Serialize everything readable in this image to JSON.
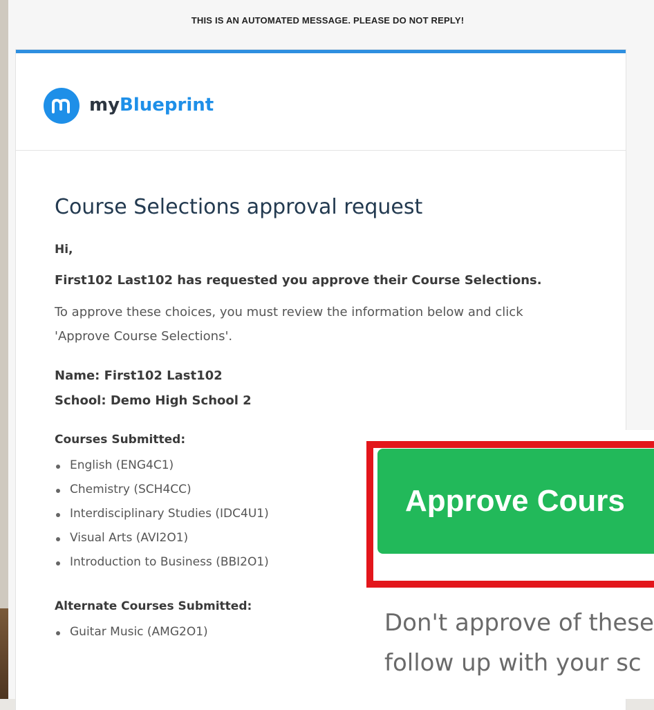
{
  "banner": {
    "text": "THIS IS AN AUTOMATED MESSAGE. PLEASE DO NOT REPLY!"
  },
  "brand": {
    "prefix": "my",
    "accent": "Blueprint",
    "logo_icon": "myblueprint-logo-icon",
    "accent_color": "#1e8fe8"
  },
  "email": {
    "title": "Course Selections approval request",
    "greeting": "Hi,",
    "requested": "First102 Last102 has requested you approve their Course Selections.",
    "instructions": "To approve these choices, you must review the information below and click 'Approve Course Selections'.",
    "name_line": "Name: First102 Last102",
    "school_line": "School: Demo High School 2",
    "courses_label": "Courses Submitted:",
    "courses": [
      "English (ENG4C1)",
      "Chemistry (SCH4CC)",
      "Interdisciplinary Studies (IDC4U1)",
      "Visual Arts (AVI2O1)",
      "Introduction to Business (BBI2O1)"
    ],
    "alternates_label": "Alternate Courses Submitted:",
    "alternates": [
      "Guitar Music (AMG2O1)"
    ]
  },
  "zoom": {
    "approve_label": "Approve Cours",
    "decline_line1": "Don't approve of these",
    "decline_line2": "follow up with your sc",
    "button_color": "#22b95a",
    "highlight_color": "#e3161b"
  }
}
